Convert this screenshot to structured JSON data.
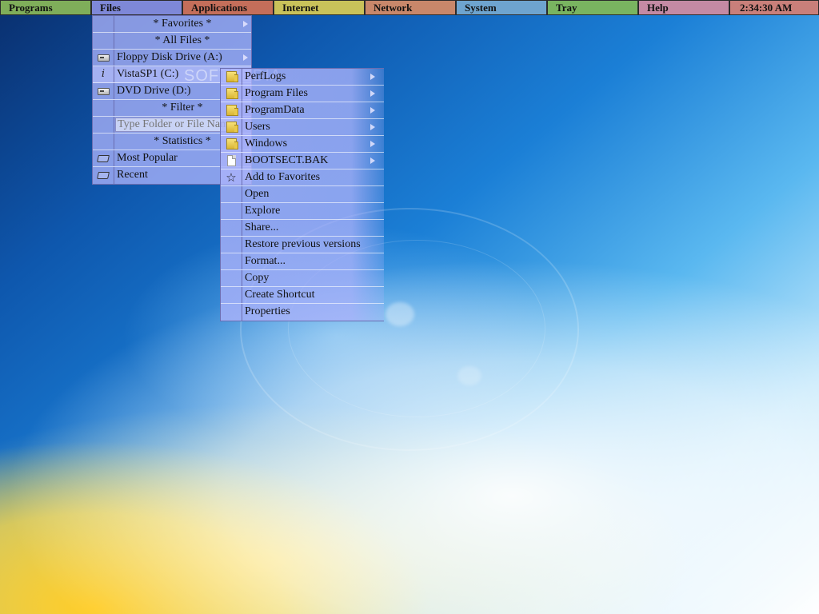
{
  "taskbar": {
    "items": [
      {
        "label": "Programs",
        "color": "#7fae5a"
      },
      {
        "label": "Files",
        "color": "#7e88d8"
      },
      {
        "label": "Applications",
        "color": "#c46e5a"
      },
      {
        "label": "Internet",
        "color": "#c9c25a"
      },
      {
        "label": "Network",
        "color": "#c8876a"
      },
      {
        "label": "System",
        "color": "#6ea4cf"
      },
      {
        "label": "Tray",
        "color": "#79b460"
      },
      {
        "label": "Help",
        "color": "#c48aa4"
      }
    ],
    "clock": {
      "label": "2:34:30 AM",
      "color": "#c97f7a"
    }
  },
  "files_menu": {
    "favorites": "* Favorites *",
    "all_files": "* All Files *",
    "floppy": "Floppy Disk Drive (A:)",
    "vista": "VistaSP1 (C:)",
    "dvd": "DVD Drive (D:)",
    "filter": "* Filter *",
    "type_placeholder": "Type Folder or File Name",
    "statistics": "* Statistics *",
    "most_popular": "Most Popular",
    "recent": "Recent"
  },
  "drive_menu": {
    "items": [
      {
        "label": "PerfLogs",
        "icon": "folder-icon"
      },
      {
        "label": "Program Files",
        "icon": "folder-icon"
      },
      {
        "label": "ProgramData",
        "icon": "folder-icon"
      },
      {
        "label": "Users",
        "icon": "folder-icon"
      },
      {
        "label": "Windows",
        "icon": "folder-icon"
      },
      {
        "label": "BOOTSECT.BAK",
        "icon": "file-icon"
      },
      {
        "label": "Add to Favorites",
        "icon": "star-icon"
      }
    ],
    "actions": [
      "Open",
      "Explore",
      "Share...",
      "Restore previous versions",
      "Format...",
      "Copy",
      "Create Shortcut",
      "Properties"
    ]
  },
  "watermark": "SOFTPEDIA"
}
